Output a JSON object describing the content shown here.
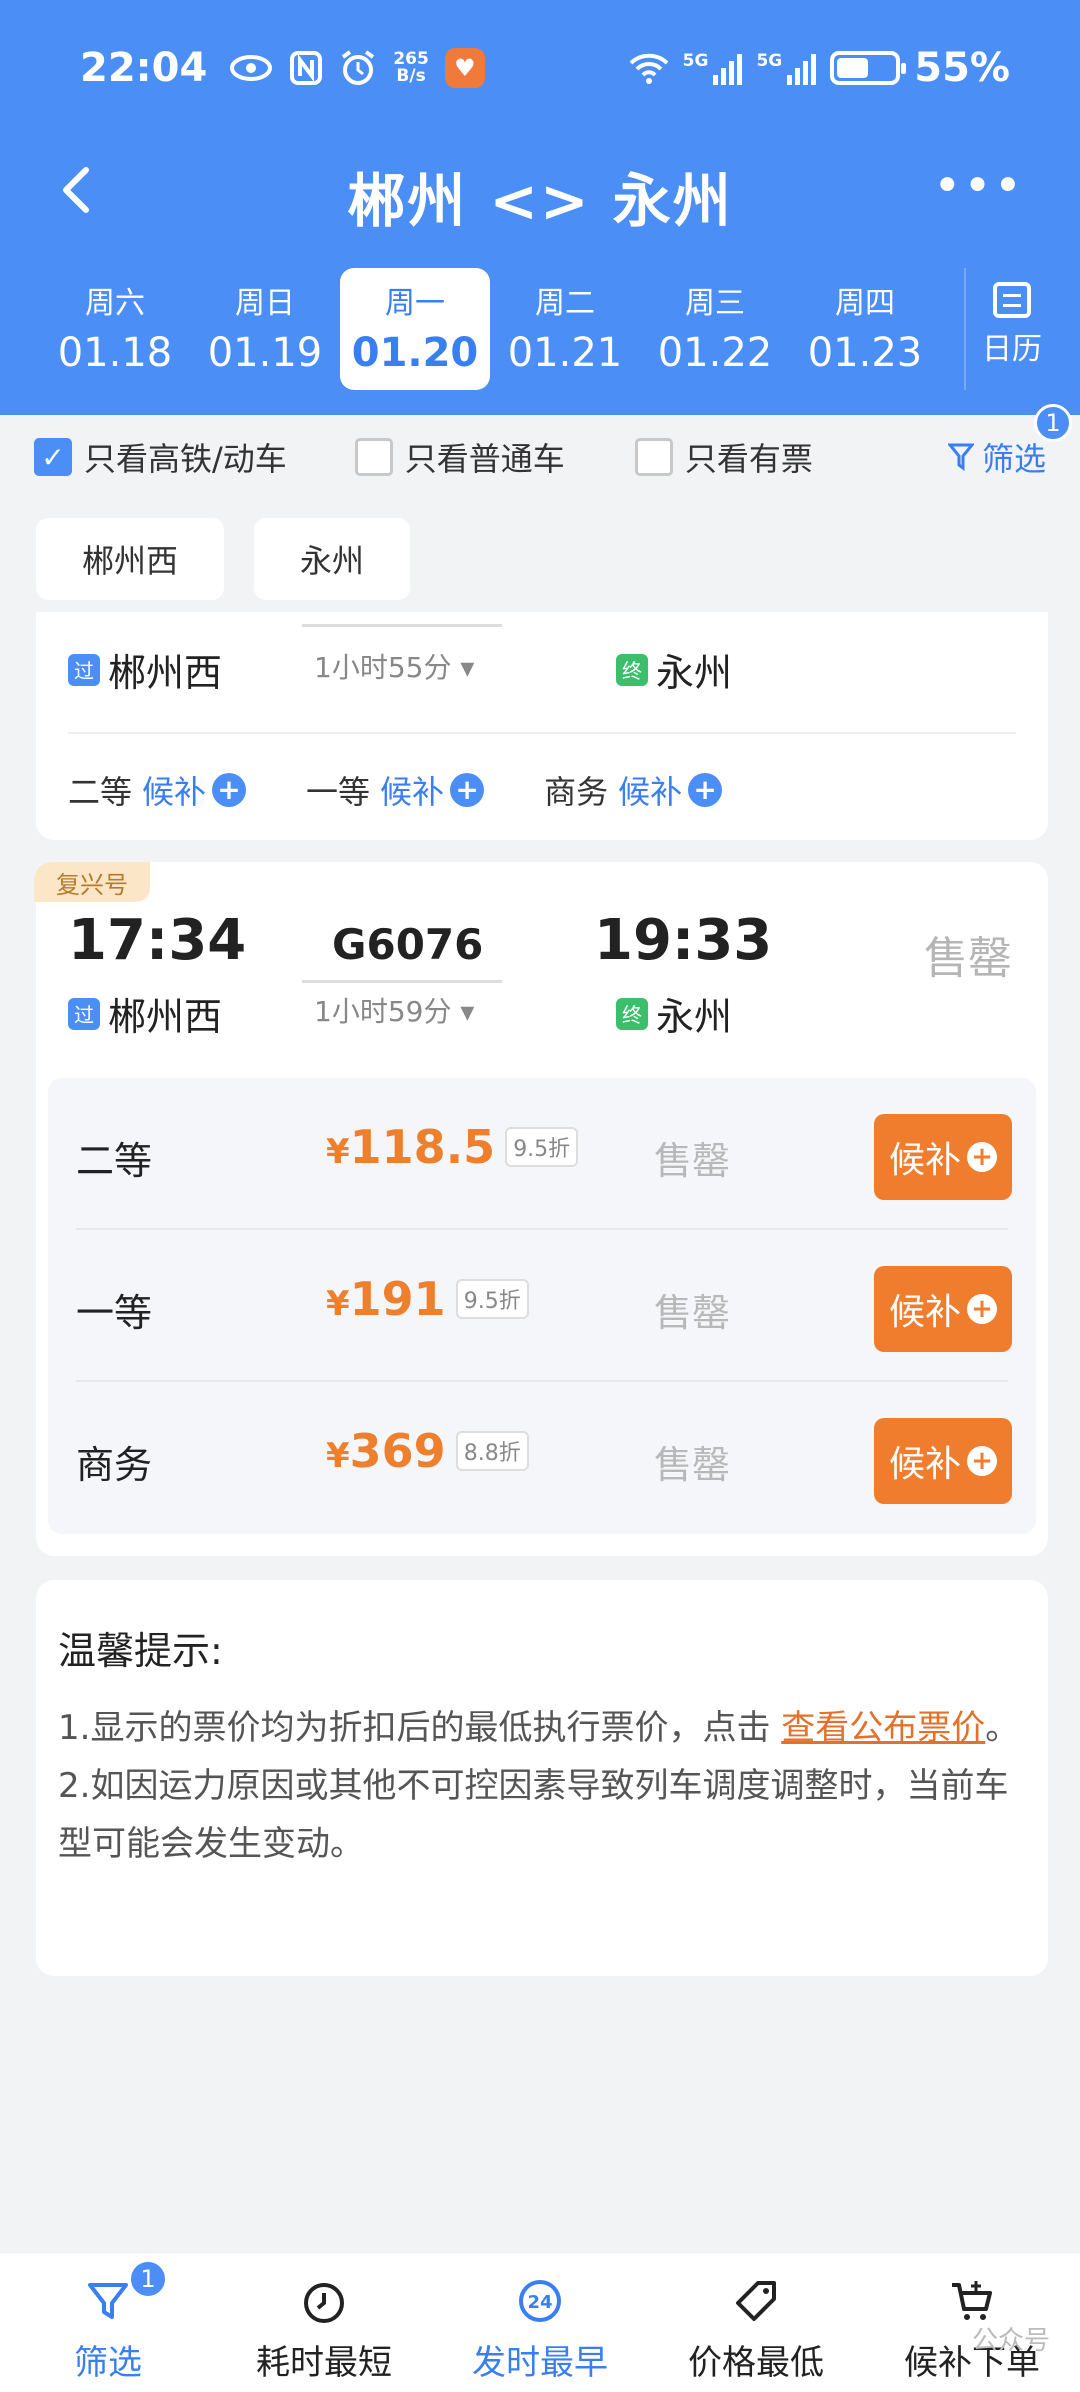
{
  "status": {
    "time": "22:04",
    "netspeed_top": "265",
    "netspeed_bottom": "B/s",
    "sig1": "5G",
    "sig2": "5G",
    "battery": "55%",
    "battery_level": 0.55
  },
  "header": {
    "title": "郴州 <> 永州",
    "more": "•••"
  },
  "dates": [
    {
      "weekday": "周六",
      "date": "01.18"
    },
    {
      "weekday": "周日",
      "date": "01.19"
    },
    {
      "weekday": "周一",
      "date": "01.20",
      "active": true
    },
    {
      "weekday": "周二",
      "date": "01.21"
    },
    {
      "weekday": "周三",
      "date": "01.22"
    },
    {
      "weekday": "周四",
      "date": "01.23"
    }
  ],
  "calendar_label": "日历",
  "filters": {
    "high_speed": "只看高铁/动车",
    "normal": "只看普通车",
    "available": "只看有票",
    "screen": "筛选",
    "screen_badge": "1"
  },
  "station_tabs": [
    "郴州西",
    "永州"
  ],
  "train1": {
    "from_tag": "过",
    "from": "郴州西",
    "duration": "1小时55分",
    "to_tag": "终",
    "to": "永州",
    "seats": [
      {
        "cls": "二等",
        "action": "候补"
      },
      {
        "cls": "一等",
        "action": "候补"
      },
      {
        "cls": "商务",
        "action": "候补"
      }
    ]
  },
  "train2": {
    "brand": "复兴号",
    "dep_time": "17:34",
    "train_no": "G6076",
    "arr_time": "19:33",
    "status": "售罄",
    "from_tag": "过",
    "from": "郴州西",
    "duration": "1小时59分",
    "to_tag": "终",
    "to": "永州",
    "prices": [
      {
        "cls": "二等",
        "yen": "¥",
        "amount": "118.5",
        "discount": "9.5折",
        "status": "售罄",
        "action": "候补"
      },
      {
        "cls": "一等",
        "yen": "¥",
        "amount": "191",
        "discount": "9.5折",
        "status": "售罄",
        "action": "候补"
      },
      {
        "cls": "商务",
        "yen": "¥",
        "amount": "369",
        "discount": "8.8折",
        "status": "售罄",
        "action": "候补"
      }
    ]
  },
  "tips": {
    "title": "温馨提示:",
    "line1_a": "1.显示的票价均为折扣后的最低执行票价，点击 ",
    "line1_link": "查看公布票价",
    "line1_b": "。",
    "line2": "2.如因运力原因或其他不可控因素导致列车调度调整时，当前车型可能会发生变动。"
  },
  "tabbar": [
    {
      "label": "筛选",
      "badge": "1"
    },
    {
      "label": "耗时最短"
    },
    {
      "label": "发时最早",
      "icon_text": "24"
    },
    {
      "label": "价格最低"
    },
    {
      "label": "候补下单"
    }
  ],
  "watermark": "公众号",
  "colors": {
    "primary": "#4b8ef5",
    "accent": "#ef7d2d"
  }
}
